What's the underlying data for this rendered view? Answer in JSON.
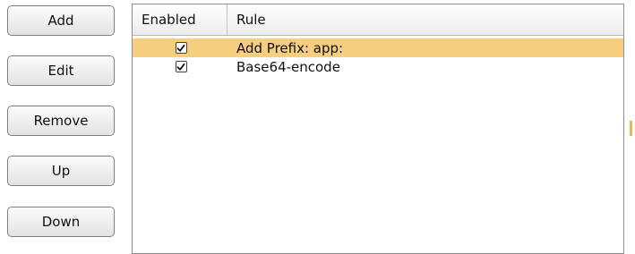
{
  "buttons": {
    "add": "Add",
    "edit": "Edit",
    "remove": "Remove",
    "up": "Up",
    "down": "Down"
  },
  "table": {
    "columns": {
      "enabled": "Enabled",
      "rule": "Rule"
    },
    "rows": [
      {
        "enabled": true,
        "rule": "Add Prefix: app:",
        "selected": true
      },
      {
        "enabled": true,
        "rule": "Base64-encode",
        "selected": false
      }
    ]
  },
  "colors": {
    "selected_row": "#f5cf7d",
    "edge_mark": "#e7b85a"
  },
  "icons": {
    "checkbox": "checked-checkbox-icon"
  }
}
